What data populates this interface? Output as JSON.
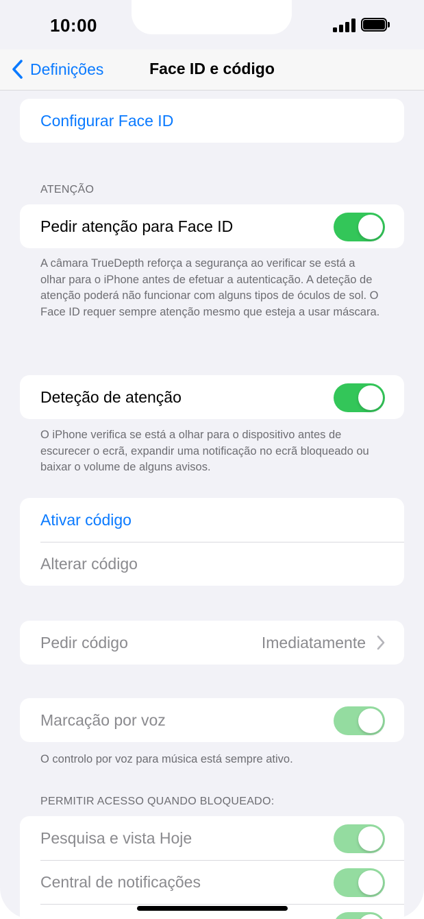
{
  "status_bar": {
    "time": "10:00"
  },
  "nav": {
    "back_label": "Definições",
    "title": "Face ID e código"
  },
  "setup": {
    "label": "Configurar Face ID"
  },
  "attention": {
    "header": "ATENÇÃO",
    "require_label": "Pedir atenção para Face ID",
    "require_on": true,
    "require_footnote": "A câmara TrueDepth reforça a segurança ao verificar se está a olhar para o iPhone antes de efetuar a autenticação. A deteção de atenção poderá não funcionar com alguns tipos de óculos de sol. O Face ID requer sempre atenção mesmo que esteja a usar máscara.",
    "aware_label": "Deteção de atenção",
    "aware_on": true,
    "aware_footnote": "O iPhone verifica se está a olhar para o dispositivo antes de escurecer o ecrã, expandir uma notificação no ecrã bloqueado ou baixar o volume de alguns avisos."
  },
  "passcode": {
    "turn_on": "Ativar código",
    "change": "Alterar código"
  },
  "require_passcode": {
    "label": "Pedir código",
    "value": "Imediatamente"
  },
  "voice_dial": {
    "label": "Marcação por voz",
    "on": true,
    "footnote": "O controlo por voz para música está sempre ativo."
  },
  "locked_access": {
    "header": "PERMITIR ACESSO QUANDO BLOQUEADO:",
    "items": [
      {
        "label": "Pesquisa e vista Hoje",
        "on": true
      },
      {
        "label": "Central de notificações",
        "on": true
      }
    ]
  },
  "colors": {
    "accent": "#0a7aff",
    "toggle_on": "#33c659",
    "toggle_disabled": "#94dca0",
    "background": "#f2f2f7"
  },
  "icons": {
    "back": "chevron-left-icon",
    "disclosure": "chevron-right-icon",
    "signal": "cellular-signal-icon",
    "battery": "battery-icon"
  }
}
